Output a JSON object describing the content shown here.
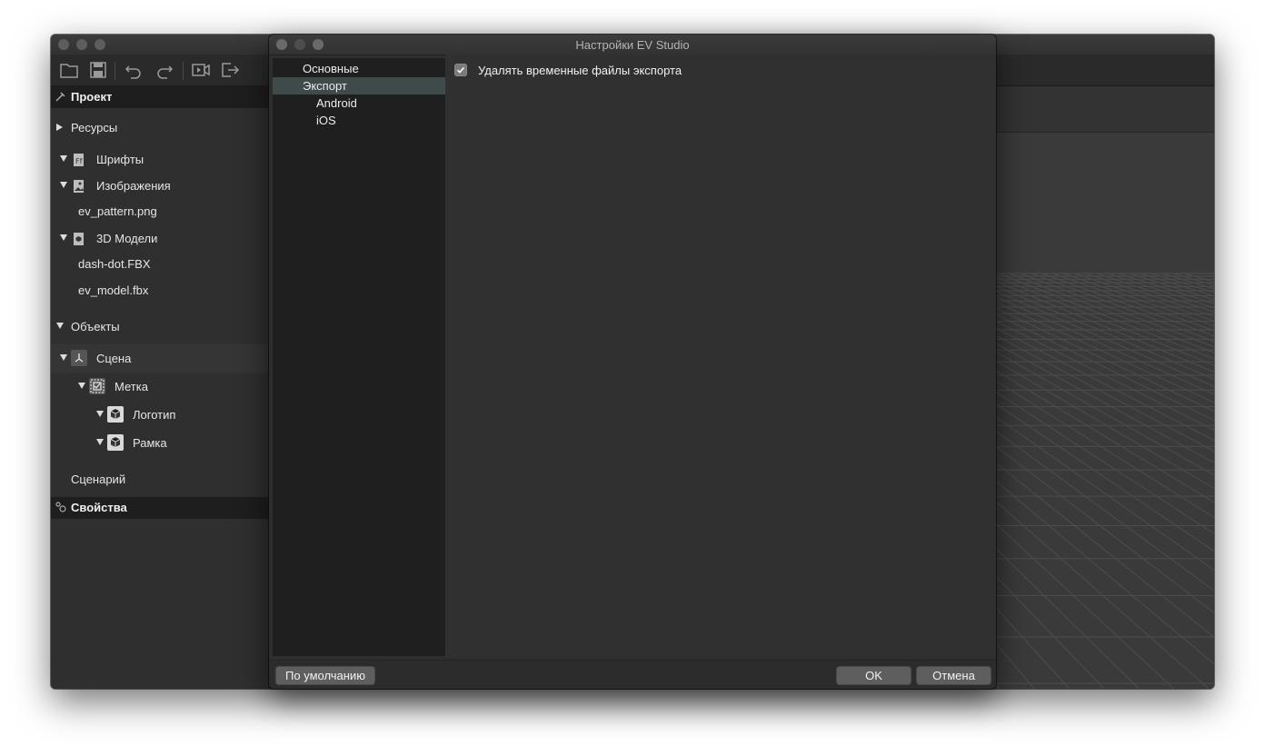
{
  "main_window": {
    "toolbar": {
      "icons": [
        "folder-open-icon",
        "save-icon",
        "undo-icon",
        "redo-icon",
        "preview-icon",
        "export-icon"
      ]
    },
    "project_panel": {
      "project_header": "Проект",
      "resources_label": "Ресурсы",
      "fonts_label": "Шрифты",
      "images_label": "Изображения",
      "image_files": [
        "ev_pattern.png"
      ],
      "models_label": "3D Модели",
      "model_files": [
        "dash-dot.FBX",
        "ev_model.fbx"
      ],
      "objects_label": "Объекты",
      "scene_label": "Сцена",
      "marker_label": "Метка",
      "logo_label": "Логотип",
      "frame_label": "Рамка",
      "scenario_label": "Сценарий",
      "properties_header": "Свойства"
    }
  },
  "dialog": {
    "title": "Настройки EV Studio",
    "nav": {
      "general": "Основные",
      "export": "Экспорт",
      "android": "Android",
      "ios": "iOS"
    },
    "selected_nav": "Экспорт",
    "content": {
      "delete_temp_files": {
        "label": "Удалять временные файлы экспорта",
        "checked": true
      }
    },
    "buttons": {
      "defaults": "По умолчанию",
      "ok": "OK",
      "cancel": "Отмена"
    }
  },
  "colors": {
    "background": "#2e2e2e",
    "nav_selected": "#3f4a4b",
    "section_header": "#1e1e1e"
  }
}
